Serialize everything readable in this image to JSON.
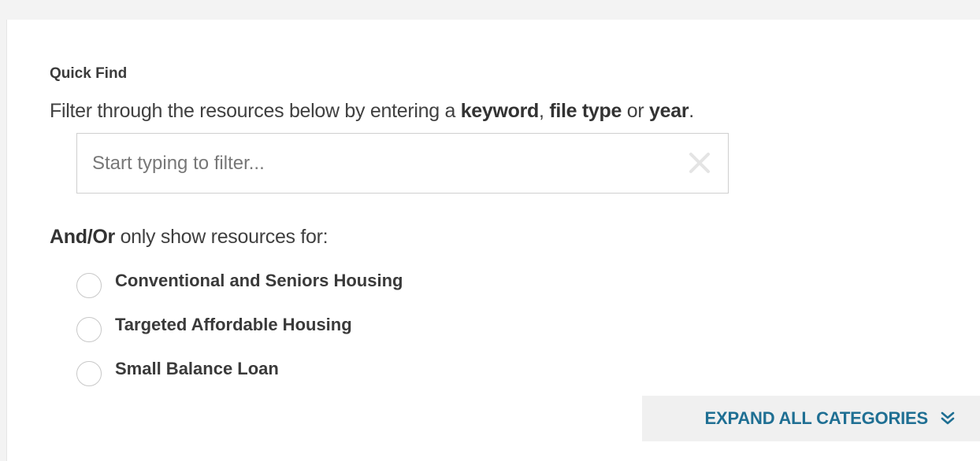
{
  "quick_find": {
    "title": "Quick Find",
    "desc_prefix": "Filter through the resources below by entering a ",
    "keyword": "keyword",
    "comma": ", ",
    "file_type": "file type",
    "or": " or ",
    "year": "year",
    "period": ".",
    "filter_placeholder": "Start typing to filter...",
    "filter_value": "",
    "clear_icon": "close-icon"
  },
  "resource_filter": {
    "andor": "And/Or",
    "label": " only show resources for:",
    "options": [
      {
        "label": "Conventional and Seniors Housing",
        "selected": false
      },
      {
        "label": "Targeted Affordable Housing",
        "selected": false
      },
      {
        "label": "Small Balance Loan",
        "selected": false
      }
    ]
  },
  "expand": {
    "label": "EXPAND ALL CATEGORIES",
    "icon": "double-chevron-down-icon"
  },
  "colors": {
    "accent": "#1f6f93",
    "background": "#f3f3f3",
    "panel": "#ffffff"
  }
}
